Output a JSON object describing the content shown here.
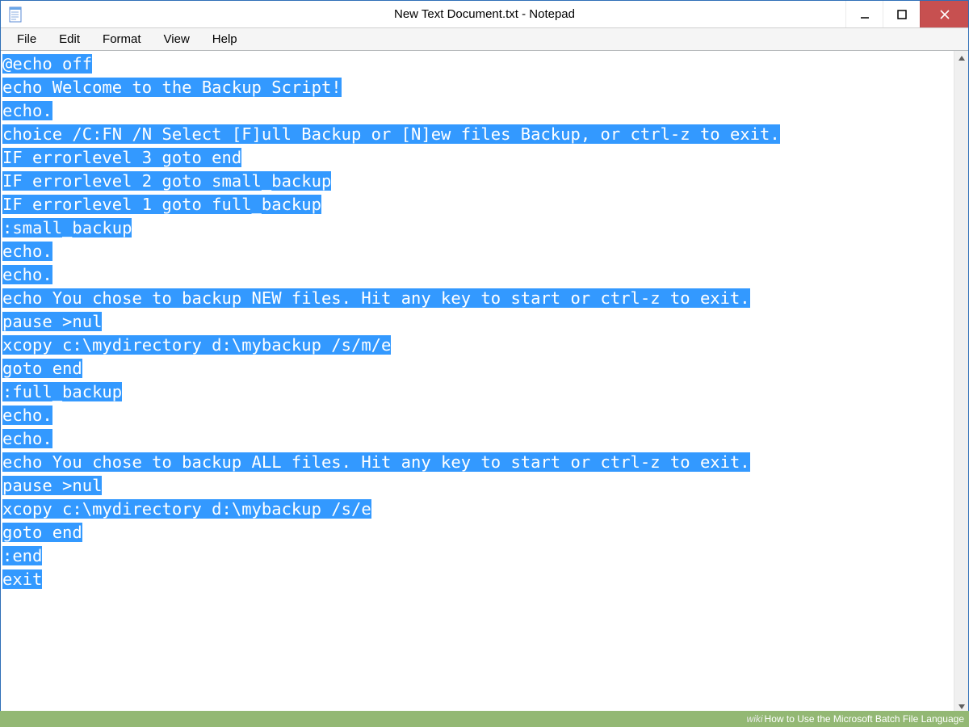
{
  "window": {
    "title": "New Text Document.txt - Notepad"
  },
  "menubar": {
    "items": [
      "File",
      "Edit",
      "Format",
      "View",
      "Help"
    ]
  },
  "editor": {
    "lines": [
      "@echo off",
      "echo Welcome to the Backup Script!",
      "echo.",
      "choice /C:FN /N Select [F]ull Backup or [N]ew files Backup, or ctrl-z to exit.",
      "IF errorlevel 3 goto end",
      "IF errorlevel 2 goto small_backup",
      "IF errorlevel 1 goto full_backup",
      ":small_backup",
      "echo.",
      "echo.",
      "echo You chose to backup NEW files. Hit any key to start or ctrl-z to exit.",
      "pause >nul",
      "xcopy c:\\mydirectory d:\\mybackup /s/m/e",
      "goto end",
      ":full_backup",
      "echo.",
      "echo.",
      "echo You chose to backup ALL files. Hit any key to start or ctrl-z to exit.",
      "pause >nul",
      "xcopy c:\\mydirectory d:\\mybackup /s/e",
      "goto end",
      ":end",
      "exit"
    ]
  },
  "footer": {
    "prefix": "wiki",
    "text": "How to Use the Microsoft Batch File Language"
  },
  "colors": {
    "selection": "#3399ff",
    "close_btn": "#c75050",
    "footer_bg": "#93b874",
    "window_border": "#2e6fb7"
  }
}
